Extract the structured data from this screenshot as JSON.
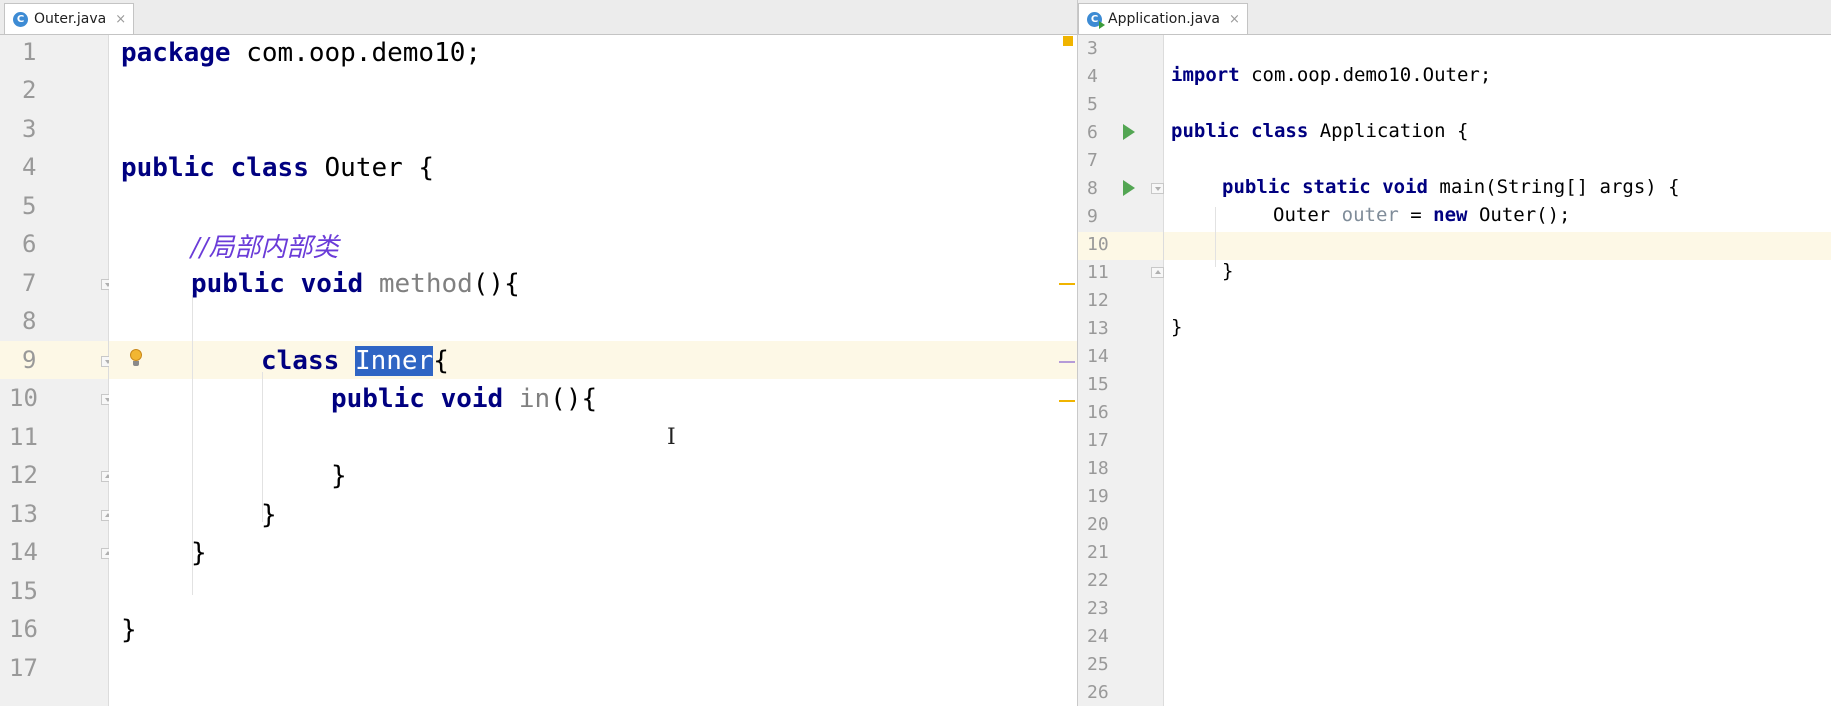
{
  "colors": {
    "keyword": "#000080",
    "comment": "#6a3bd8",
    "selection": "#2f65c4",
    "current_line": "#fdf8e6",
    "gutter": "#f0f0f0",
    "run_icon": "#53a653",
    "warning_marker": "#f0b400",
    "tab_icon": "#3d8bd4"
  },
  "left_tab": {
    "icon": "class-c-icon",
    "icon_letter": "C",
    "label": "Outer.java",
    "close": "×"
  },
  "right_tab": {
    "icon": "class-c-runnable-icon",
    "icon_letter": "C",
    "label": "Application.java",
    "close": "×"
  },
  "left_editor": {
    "line_numbers": [
      "1",
      "2",
      "3",
      "4",
      "5",
      "6",
      "7",
      "8",
      "9",
      "10",
      "11",
      "12",
      "13",
      "14",
      "15",
      "16",
      "17"
    ],
    "code": {
      "l1": {
        "kw": "package",
        "rest": " com.oop.demo10;"
      },
      "l4": {
        "kw1": "public",
        "kw2": "class",
        "rest": " Outer {"
      },
      "l6": {
        "comment": "//局部内部类"
      },
      "l7": {
        "kw1": "public",
        "kw2": "void",
        "method": "method",
        "rest": "(){"
      },
      "l9": {
        "kw": "class",
        "selected": "Inner",
        "rest": "{"
      },
      "l10": {
        "kw1": "public",
        "kw2": "void",
        "method": "in",
        "rest": "(){"
      },
      "l12": {
        "rest": "}"
      },
      "l13": {
        "rest": "}"
      },
      "l14": {
        "rest": "}"
      },
      "l16": {
        "rest": "}"
      }
    }
  },
  "right_editor": {
    "line_numbers": [
      "3",
      "4",
      "5",
      "6",
      "7",
      "8",
      "9",
      "10",
      "11",
      "12",
      "13",
      "14",
      "15",
      "16",
      "17",
      "18",
      "19",
      "20",
      "21",
      "22",
      "23",
      "24",
      "25",
      "26"
    ],
    "code": {
      "l4": {
        "kw": "import",
        "rest": " com.oop.demo10.Outer;"
      },
      "l6": {
        "kw1": "public",
        "kw2": "class",
        "rest": " Application {"
      },
      "l8": {
        "kw1": "public",
        "kw2": "static",
        "kw3": "void",
        "rest": " main(String[] args) {"
      },
      "l9": {
        "type": "Outer ",
        "var": "outer",
        "mid": " = ",
        "kw": "new",
        "rest": " Outer();"
      },
      "l11": {
        "rest": "}"
      },
      "l13": {
        "rest": "}"
      }
    }
  }
}
